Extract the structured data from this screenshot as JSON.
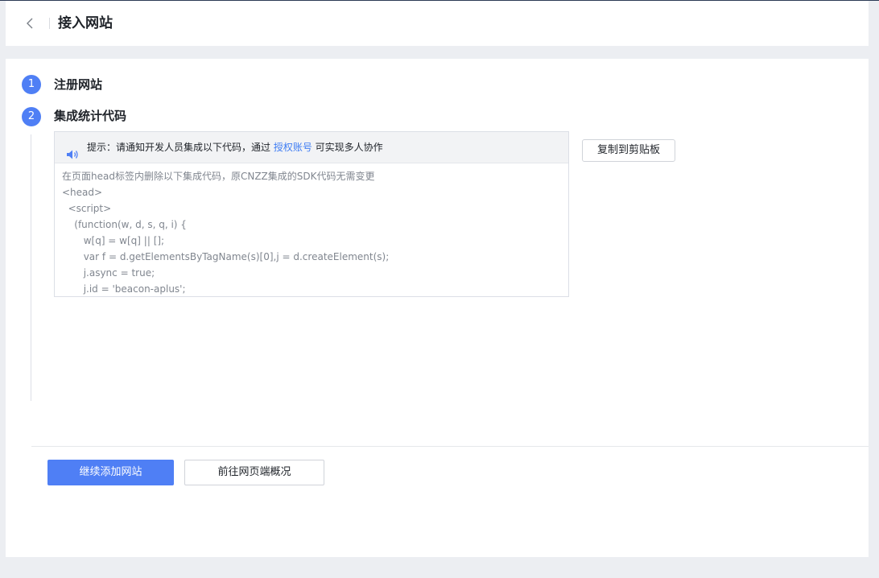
{
  "header": {
    "title": "接入网站"
  },
  "steps": [
    {
      "number": "1",
      "title": "注册网站"
    },
    {
      "number": "2",
      "title": "集成统计代码"
    }
  ],
  "tip": {
    "prefix": "提示：请通知开发人员集成以下代码，通过 ",
    "link": "授权账号",
    "suffix": " 可实现多人协作"
  },
  "code": {
    "lines": "在页面head标签内删除以下集成代码，原CNZZ集成的SDK代码无需变更\n<head>\n  <script>\n    (function(w, d, s, q, i) {\n       w[q] = w[q] || [];\n       var f = d.getElementsByTagName(s)[0],j = d.createElement(s);\n       j.async = true;\n       j.id = 'beacon-aplus';"
  },
  "buttons": {
    "copy": "复制到剪贴板",
    "continue": "继续添加网站",
    "overview": "前往网页端概况"
  },
  "colors": {
    "accent": "#4f7ff5",
    "link": "#3f7df3"
  }
}
